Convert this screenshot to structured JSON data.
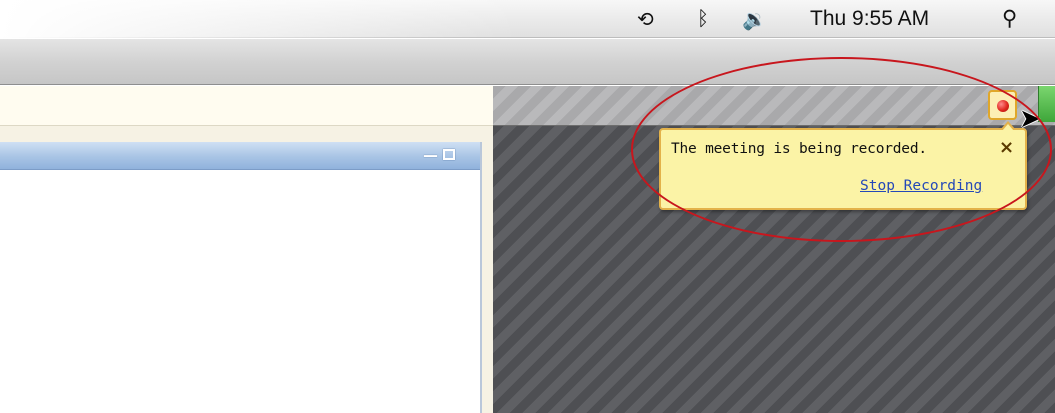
{
  "menubar": {
    "time_machine_icon": "clock-arrow-icon",
    "bluetooth_icon": "bluetooth-icon",
    "volume_icon": "volume-icon",
    "clock": "Thu 9:55 AM",
    "spotlight_icon": "search-icon"
  },
  "meeting": {
    "record_indicator": "recording-dot-icon",
    "notification": {
      "message": "The meeting is being recorded.",
      "close": "×",
      "action": "Stop Recording"
    }
  },
  "inner_panel": {
    "controls": [
      "minimize",
      "maximize"
    ]
  },
  "colors": {
    "notification_bg": "#fbf3a6",
    "notification_border": "#e3b24a",
    "link": "#2448b8",
    "highlight": "#c8161d",
    "record_red": "#e0281e"
  }
}
